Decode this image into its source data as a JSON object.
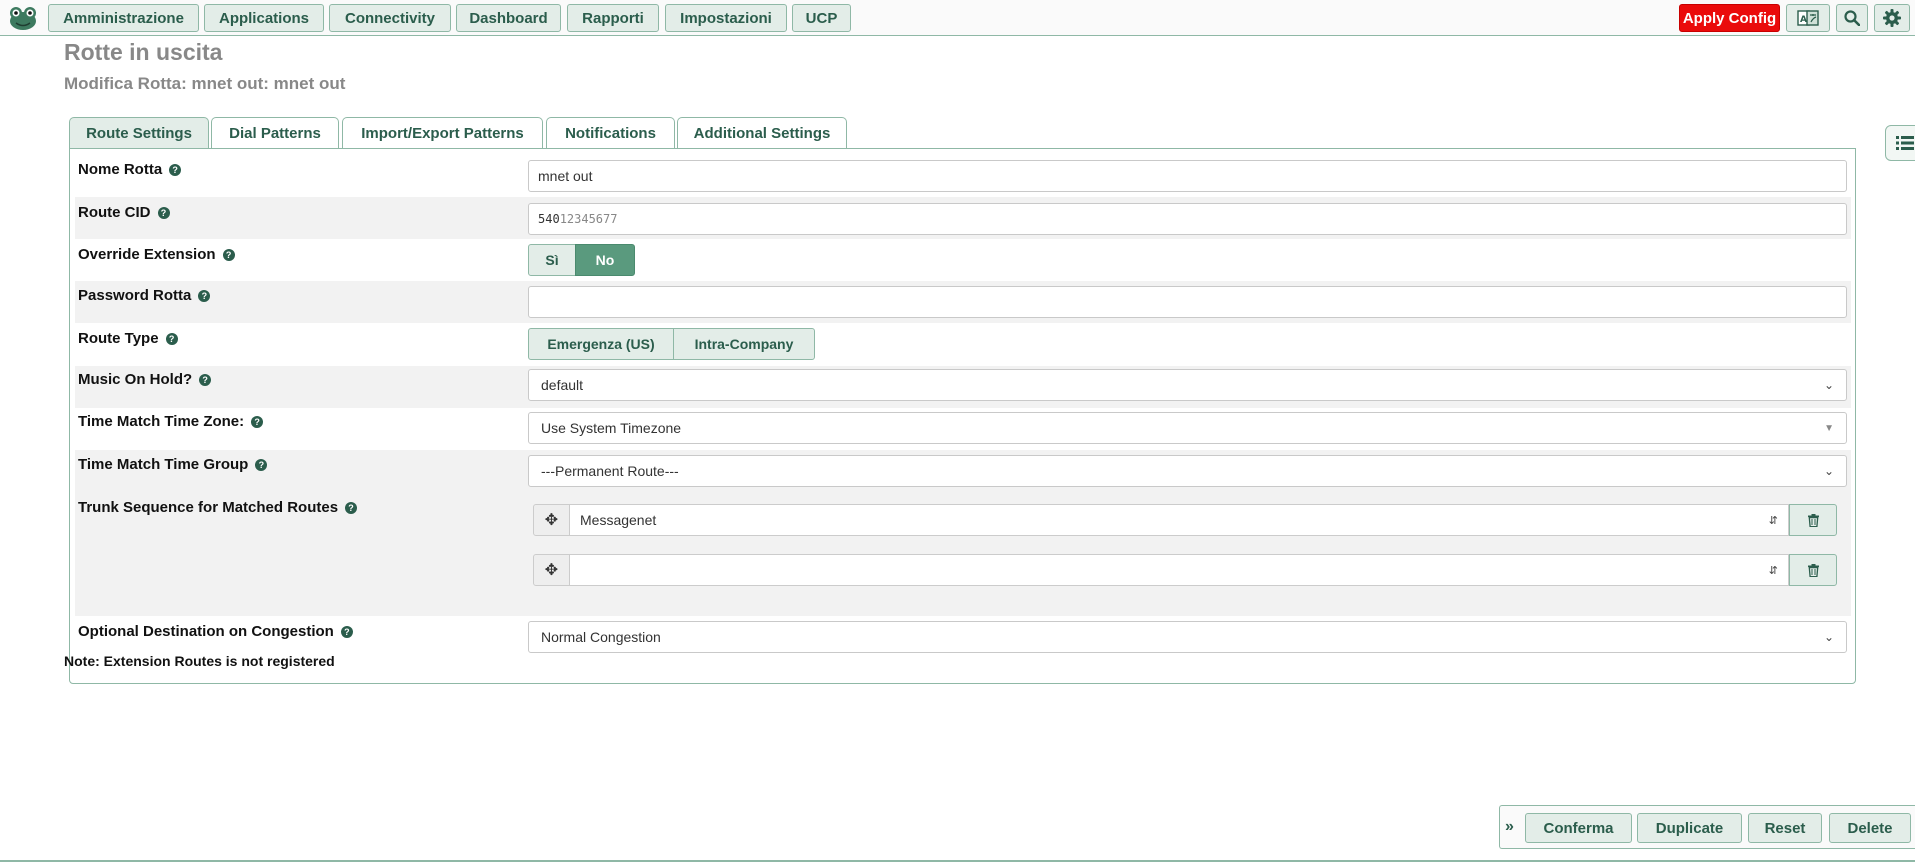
{
  "navbar": {
    "items": [
      "Amministrazione",
      "Applications",
      "Connectivity",
      "Dashboard",
      "Rapporti",
      "Impostazioni",
      "UCP"
    ],
    "apply_config": "Apply Config",
    "icons": [
      "frog-logo-icon",
      "language-icon",
      "search-icon",
      "gear-icon"
    ]
  },
  "header": {
    "title": "Rotte in uscita",
    "subtitle": "Modifica Rotta: mnet out: mnet out"
  },
  "tabs": [
    "Route Settings",
    "Dial Patterns",
    "Import/Export Patterns",
    "Notifications",
    "Additional Settings"
  ],
  "form": {
    "route_name": {
      "label": "Nome Rotta",
      "value": "mnet out"
    },
    "route_cid": {
      "label": "Route CID",
      "value_prefix": "540",
      "value_placeholder": "12345677"
    },
    "override_extension": {
      "label": "Override Extension",
      "options": [
        "Sì",
        "No"
      ],
      "selected": "No"
    },
    "route_password": {
      "label": "Password Rotta",
      "value": ""
    },
    "route_type": {
      "label": "Route Type",
      "options": [
        "Emergenza (US)",
        "Intra-Company"
      ]
    },
    "music_on_hold": {
      "label": "Music On Hold?",
      "value": "default"
    },
    "time_zone": {
      "label": "Time Match Time Zone:",
      "value": "Use System Timezone"
    },
    "time_group": {
      "label": "Time Match Time Group",
      "value": "---Permanent Route---"
    },
    "trunk_sequence": {
      "label": "Trunk Sequence for Matched Routes",
      "trunks": [
        "Messagenet",
        ""
      ]
    },
    "congestion": {
      "label": "Optional Destination on Congestion",
      "value": "Normal Congestion"
    },
    "note": "Note: Extension Routes is not registered"
  },
  "footer": {
    "buttons": [
      "Conferma",
      "Duplicate",
      "Reset",
      "Delete"
    ]
  },
  "colors": {
    "accent": "#2b5d4c",
    "button_bg": "#e3ede8",
    "border": "#8fb8a6",
    "apply": "#ea0b0b",
    "selected": "#5a9a7e"
  }
}
